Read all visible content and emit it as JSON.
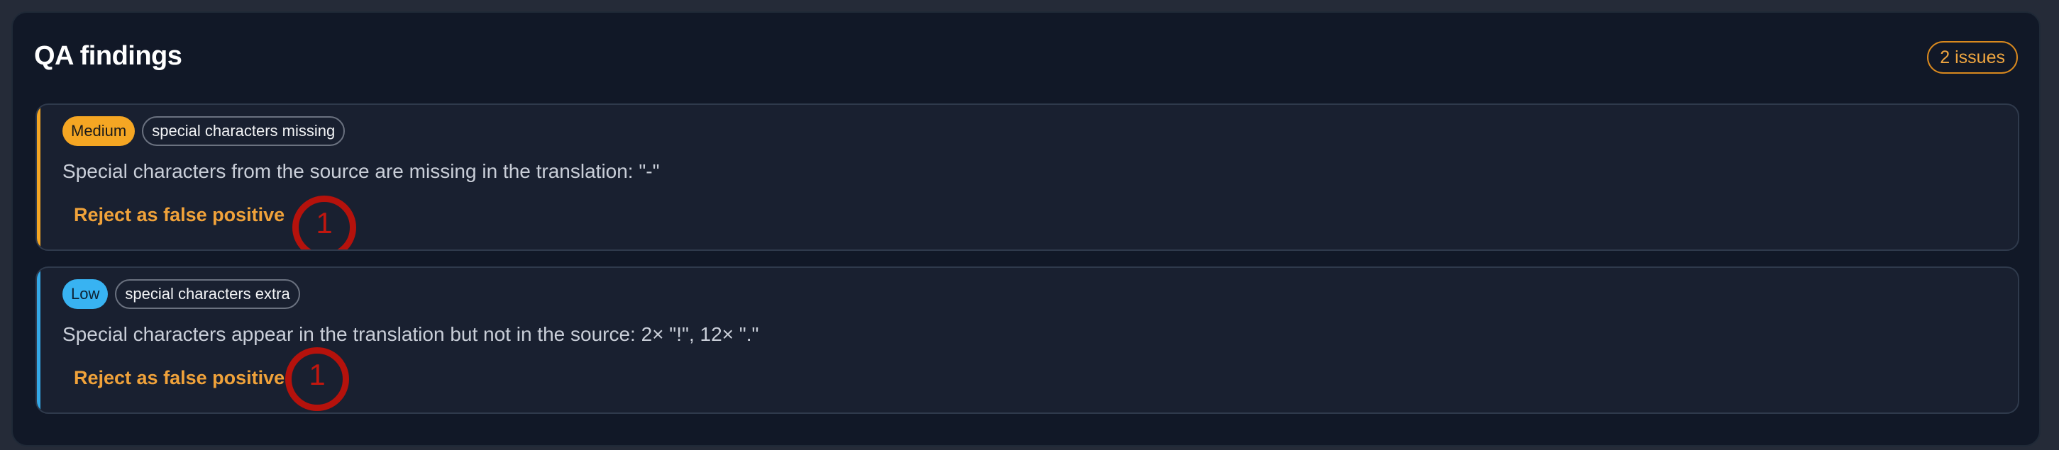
{
  "panel": {
    "title": "QA findings",
    "count_label": "2 issues"
  },
  "findings": [
    {
      "severity": "Medium",
      "type": "special characters missing",
      "message": "Special characters from the source are missing in the translation: \"-\"",
      "action_label": "Reject as false positive",
      "marker": "1"
    },
    {
      "severity": "Low",
      "type": "special characters extra",
      "message": "Special characters appear in the translation but not in the source: 2× \"!\", 12× \".\"",
      "action_label": "Reject as false positive",
      "marker": "1"
    }
  ],
  "colors": {
    "medium": "#f5a623",
    "low": "#38b3f2",
    "action": "#f0a23a",
    "marker": "#b5120c"
  }
}
